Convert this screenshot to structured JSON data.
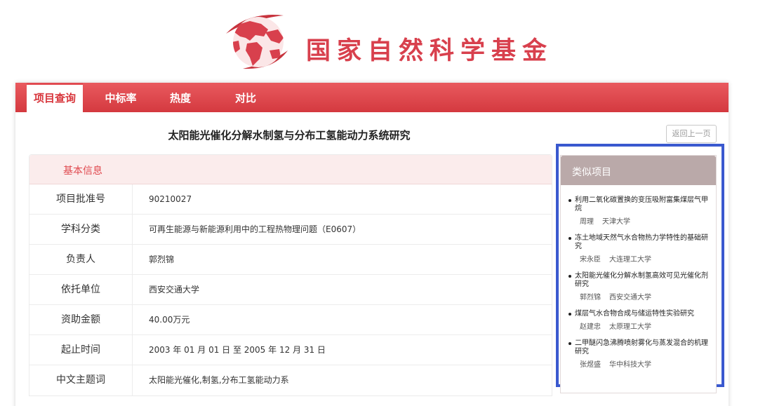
{
  "logo": {
    "title": "国家自然科学基金",
    "globe_icon": "globe-map-icon",
    "brand_color": "#d8404d"
  },
  "nav": {
    "tabs": [
      {
        "label": "项目查询",
        "active": true
      },
      {
        "label": "中标率",
        "active": false
      },
      {
        "label": "热度",
        "active": false
      },
      {
        "label": "对比",
        "active": false
      }
    ]
  },
  "project": {
    "title": "太阳能光催化分解水制氢与分布工氢能动力系统研究",
    "back_button": "返回上一页"
  },
  "basic_info": {
    "header": "基本信息",
    "rows": [
      {
        "label": "项目批准号",
        "value": "90210027"
      },
      {
        "label": "学科分类",
        "value": "可再生能源与新能源利用中的工程热物理问题（E0607）"
      },
      {
        "label": "负责人",
        "value": "郭烈锦"
      },
      {
        "label": "依托单位",
        "value": "西安交通大学"
      },
      {
        "label": "资助金额",
        "value": "40.00万元"
      },
      {
        "label": "起止时间",
        "value": "2003 年 01 月 01 日 至 2005 年 12 月 31 日"
      },
      {
        "label": "中文主题词",
        "value": "太阳能光催化,制氢,分布工氢能动力系"
      }
    ]
  },
  "similar": {
    "header": "类似项目",
    "items": [
      {
        "title": "利用二氧化碳置换的变压吸附富集煤层气甲烷",
        "person": "周理",
        "org": "天津大学"
      },
      {
        "title": "冻土地域天然气水合物热力学特性的基础研究",
        "person": "宋永臣",
        "org": "大连理工大学"
      },
      {
        "title": "太阳能光催化分解水制氢高效可见光催化剂研究",
        "person": "郭烈锦",
        "org": "西安交通大学"
      },
      {
        "title": "煤层气水合物合成与储运特性实验研究",
        "person": "赵建忠",
        "org": "太原理工大学"
      },
      {
        "title": "二甲醚闪急沸腾喷射雾化与蒸发混合的机理研究",
        "person": "张煜盛",
        "org": "华中科技大学"
      }
    ]
  },
  "colors": {
    "nav_red": "#d4393f",
    "highlight_border": "#3a59cf",
    "similar_header": "#baa9a9"
  }
}
